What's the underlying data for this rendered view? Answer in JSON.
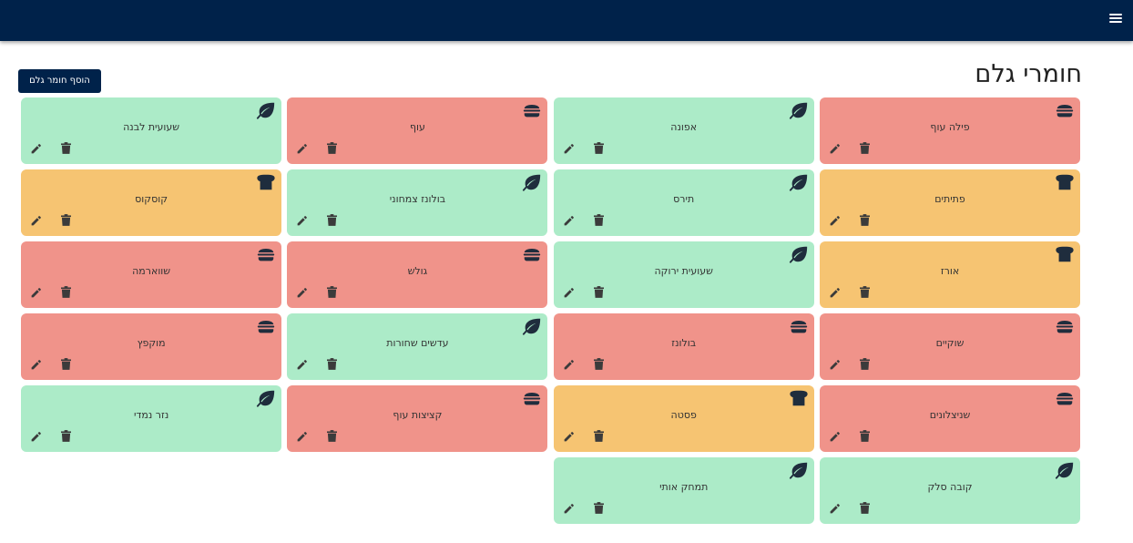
{
  "header": {
    "menu_icon": "hamburger-menu-icon"
  },
  "page": {
    "title": "חומרי גלם",
    "add_button_label": "הוסף חומר גלם"
  },
  "colors": {
    "header_bg": "#00224a",
    "meat_bg": "#f0938a",
    "veg_bg": "#acebc8",
    "carb_bg": "#f6c472",
    "icon_dark": "#1f2d3d"
  },
  "icons": {
    "meat": "burger-icon",
    "veg": "leaf-icon",
    "carb": "bread-icon",
    "edit": "pencil-icon",
    "delete": "trash-icon"
  },
  "ingredients": [
    {
      "name": "פילה עוף",
      "category": "meat"
    },
    {
      "name": "אפונה",
      "category": "veg"
    },
    {
      "name": "עוף",
      "category": "meat"
    },
    {
      "name": "שעועית לבנה",
      "category": "veg"
    },
    {
      "name": "פתיתים",
      "category": "carb"
    },
    {
      "name": "תירס",
      "category": "veg"
    },
    {
      "name": "בולונז צמחוני",
      "category": "veg"
    },
    {
      "name": "קוסקוס",
      "category": "carb"
    },
    {
      "name": "אורז",
      "category": "carb"
    },
    {
      "name": "שעועית ירוקה",
      "category": "veg"
    },
    {
      "name": "גולש",
      "category": "meat"
    },
    {
      "name": "שווארמה",
      "category": "meat"
    },
    {
      "name": "שוקיים",
      "category": "meat"
    },
    {
      "name": "בולונז",
      "category": "meat"
    },
    {
      "name": "עדשים שחורות",
      "category": "veg"
    },
    {
      "name": "מוקפץ",
      "category": "meat"
    },
    {
      "name": "שניצלונים",
      "category": "meat"
    },
    {
      "name": "פסטה",
      "category": "carb"
    },
    {
      "name": "קציצות עוף",
      "category": "meat"
    },
    {
      "name": "נזר נמדי",
      "category": "veg"
    },
    {
      "name": "קובה סלק",
      "category": "veg"
    },
    {
      "name": "תמחק אותי",
      "category": "veg"
    }
  ]
}
